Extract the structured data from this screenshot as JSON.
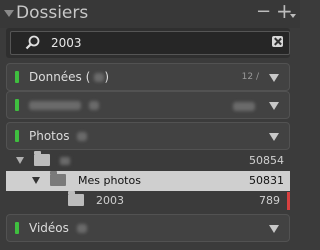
{
  "header": {
    "title": "Dossiers",
    "minus": "−",
    "plus": "+"
  },
  "search": {
    "value": "2003"
  },
  "sections": {
    "donnees": {
      "label": "Données",
      "count": "12 /"
    },
    "hidden": {
      "label": ""
    },
    "photos": {
      "label": "Photos"
    },
    "videos": {
      "label": "Vidéos"
    }
  },
  "tree": {
    "root": {
      "label": "",
      "count": "50854"
    },
    "mes_photos": {
      "label": "Mes photos",
      "count": "50831"
    },
    "year_2003": {
      "label": "2003",
      "count": "789"
    }
  },
  "colors": {
    "status_dot": "#3fbf3f",
    "marker": "#d84040"
  }
}
